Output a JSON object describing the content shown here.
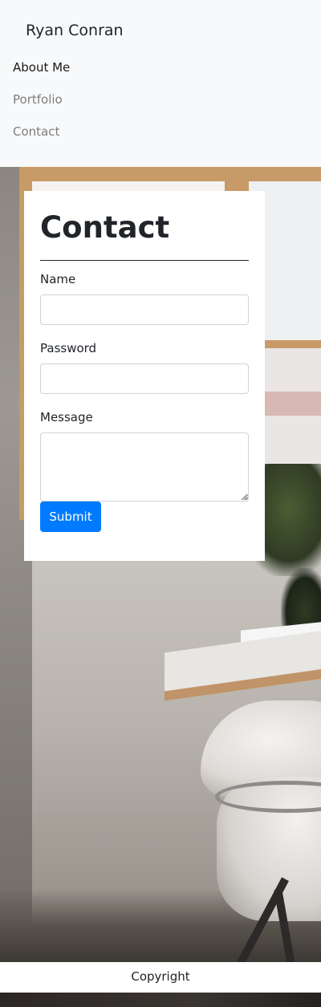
{
  "navbar": {
    "brand": "Ryan Conran",
    "links": [
      {
        "label": "About Me",
        "active": true
      },
      {
        "label": "Portfolio",
        "active": false
      },
      {
        "label": "Contact",
        "active": false
      }
    ]
  },
  "contact_form": {
    "title": "Contact",
    "fields": {
      "name": {
        "label": "Name",
        "value": ""
      },
      "password": {
        "label": "Password",
        "value": ""
      },
      "message": {
        "label": "Message",
        "value": ""
      }
    },
    "submit_label": "Submit"
  },
  "footer": {
    "text": "Copyright"
  },
  "colors": {
    "navbar_bg": "#f8f9fa",
    "primary": "#007bff",
    "text": "#212529"
  }
}
